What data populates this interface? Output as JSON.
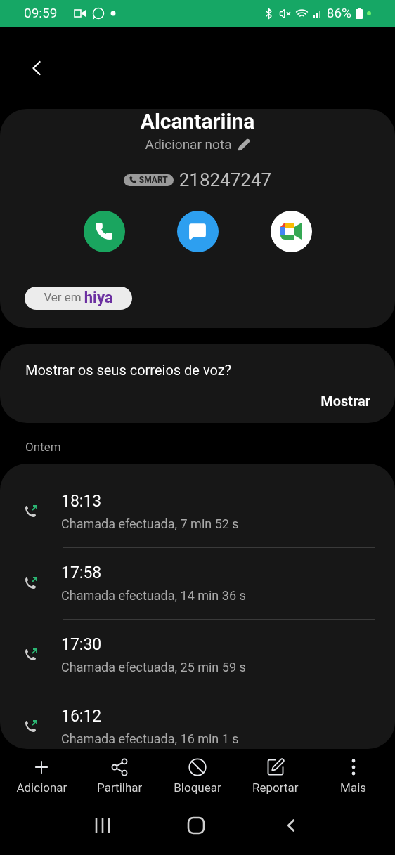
{
  "status_bar": {
    "time": "09:59",
    "battery": "86%"
  },
  "contact": {
    "name": "Alcantariina",
    "note": "Adicionar nota",
    "badge": "SMART",
    "number": "218247247",
    "hiya": {
      "prefix": "Ver em",
      "logo": "hiya"
    }
  },
  "voicemail": {
    "question": "Mostrar os seus correios de voz?",
    "action": "Mostrar"
  },
  "section": "Ontem",
  "calls": [
    {
      "time": "18:13",
      "detail": "Chamada efectuada, 7 min 52 s"
    },
    {
      "time": "17:58",
      "detail": "Chamada efectuada, 14 min 36 s"
    },
    {
      "time": "17:30",
      "detail": "Chamada efectuada, 25 min 59 s"
    },
    {
      "time": "16:12",
      "detail": "Chamada efectuada, 16 min 1 s"
    }
  ],
  "toolbar": [
    {
      "kind": "add",
      "label": "Adicionar"
    },
    {
      "kind": "share",
      "label": "Partilhar"
    },
    {
      "kind": "block",
      "label": "Bloquear"
    },
    {
      "kind": "report",
      "label": "Reportar"
    },
    {
      "kind": "more",
      "label": "Mais"
    }
  ]
}
